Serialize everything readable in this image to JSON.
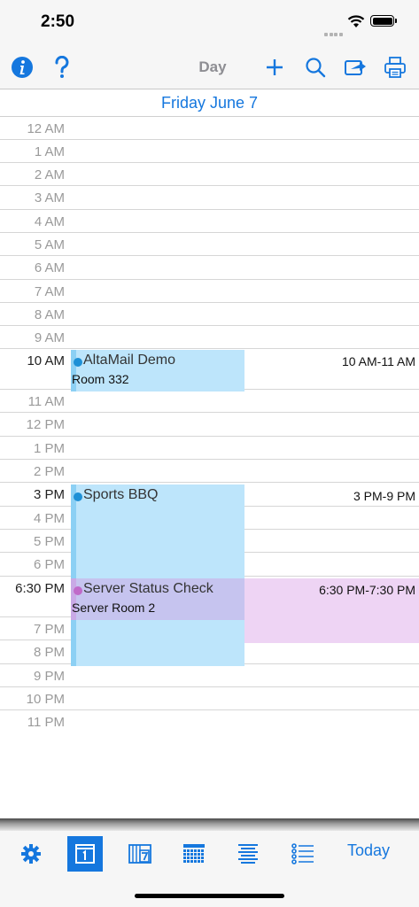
{
  "status_bar": {
    "time": "2:50"
  },
  "toolbar": {
    "view_title": "Day",
    "icons": [
      "info-icon",
      "help-icon",
      "add-icon",
      "search-icon",
      "share-icon",
      "print-icon"
    ]
  },
  "date_header": "Friday June 7",
  "hours": [
    "12 AM",
    "1 AM",
    "2 AM",
    "3 AM",
    "4 AM",
    "5 AM",
    "6 AM",
    "7 AM",
    "8 AM",
    "9 AM",
    "10 AM",
    "11 AM",
    "12 PM",
    "1 PM",
    "2 PM",
    "3 PM",
    "4 PM",
    "5 PM",
    "6 PM",
    "6:30 PM",
    "7 PM",
    "8 PM",
    "9 PM",
    "10 PM",
    "11 PM"
  ],
  "events": [
    {
      "title": "AltaMail Demo",
      "location": "Room 332",
      "time_range": "10 AM-11 AM",
      "color": "#bde5fb",
      "dot_color": "#1e90d6"
    },
    {
      "title": "Sports BBQ",
      "location": "",
      "time_range": "3 PM-9 PM",
      "color": "#bde5fb",
      "dot_color": "#1e90d6"
    },
    {
      "title": "Server Status Check",
      "location": "Server Room 2",
      "time_range": "6:30 PM-7:30 PM",
      "color": "#eed4f4",
      "dot_color": "#c06ac9"
    }
  ],
  "tab_bar": {
    "today_label": "Today",
    "tabs": [
      "settings-icon",
      "day-view-icon",
      "week-view-icon",
      "month-view-icon",
      "agenda-view-icon",
      "list-view-icon"
    ]
  },
  "colors": {
    "accent": "#1577de",
    "event_blue": "#bde5fb",
    "event_purple": "#eed4f4"
  }
}
